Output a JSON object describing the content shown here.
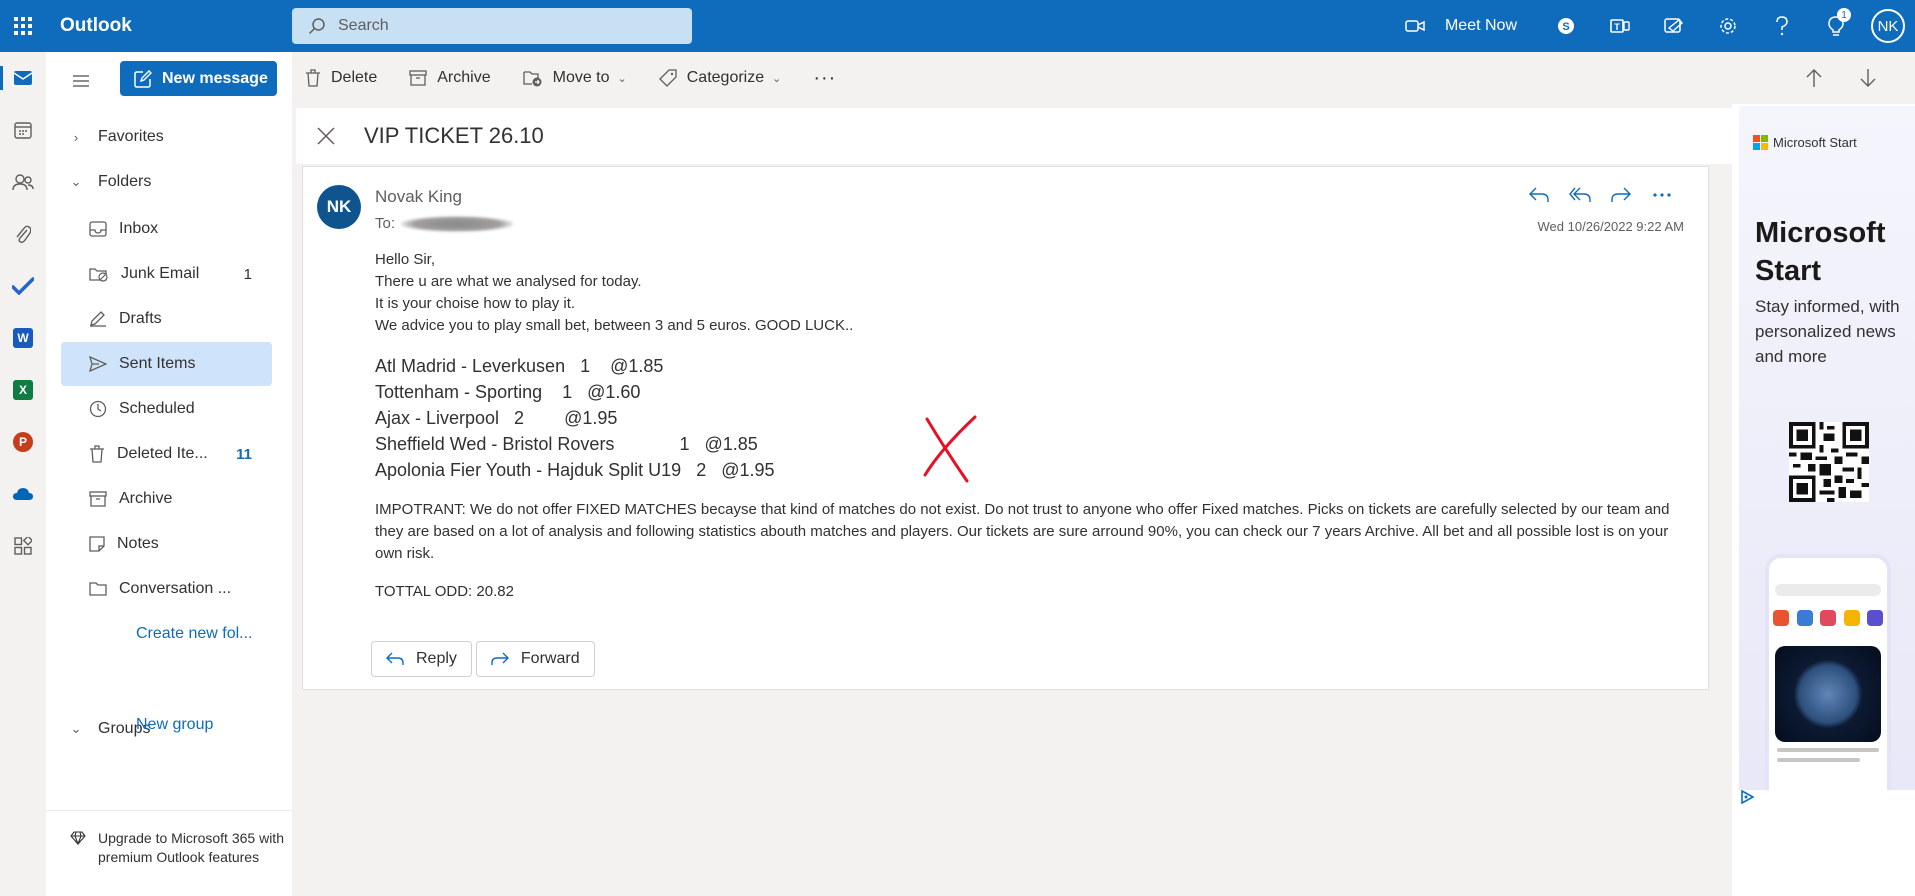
{
  "topbar": {
    "app_name": "Outlook",
    "search_placeholder": "Search",
    "meet_now": "Meet Now",
    "notification_count": "1",
    "user_initials": "NK",
    "colors": {
      "brand": "#0f6cbd",
      "search_bg": "#c7e0f4"
    }
  },
  "folders": {
    "new_message": "New message",
    "favorites": "Favorites",
    "folders_head": "Folders",
    "items": [
      {
        "label": "Inbox",
        "count": ""
      },
      {
        "label": "Junk Email",
        "count": "1"
      },
      {
        "label": "Drafts",
        "count": ""
      },
      {
        "label": "Sent Items",
        "count": ""
      },
      {
        "label": "Scheduled",
        "count": ""
      },
      {
        "label": "Deleted Ite...",
        "count": "11"
      },
      {
        "label": "Archive",
        "count": ""
      },
      {
        "label": "Notes",
        "count": ""
      },
      {
        "label": "Conversation ...",
        "count": ""
      }
    ],
    "create_new": "Create new fol...",
    "groups": "Groups",
    "new_group": "New group",
    "upgrade": "Upgrade to Microsoft 365 with premium Outlook features"
  },
  "commands": {
    "delete": "Delete",
    "archive": "Archive",
    "move_to": "Move to",
    "categorize": "Categorize",
    "more": "···"
  },
  "message": {
    "subject": "VIP TICKET 26.10",
    "sender_initials": "NK",
    "sender": "Novak King",
    "to_label": "To:",
    "date": "Wed 10/26/2022 9:22 AM",
    "greeting": [
      "Hello Sir,",
      "There u are what we analysed for today.",
      "It is your choise how to play it.",
      "We advice you to play small bet, between 3 and 5 euros. GOOD LUCK.."
    ],
    "picks": [
      "Atl Madrid - Leverkusen   1    @1.85",
      "Tottenham - Sporting    1   @1.60",
      "Ajax - Liverpool   2        @1.95",
      "Sheffield Wed - Bristol Rovers             1   @1.85",
      "Apolonia Fier Youth - Hajduk Split U19   2   @1.95"
    ],
    "notice": "IMPOTRANT: We do not offer FIXED MATCHES becayse that kind of matches do not exist. Do not trust to anyone who offer Fixed matches. Picks on tickets are carefully selected by our team and they are based on a lot of analysis and following statistics abouth matches and players. Our tickets are sure arround 90%, you can check our 7 years Archive. All bet and all possible lost is on your own risk.",
    "total": "TOTTAL ODD: 20.82",
    "reply": "Reply",
    "forward": "Forward"
  },
  "ad": {
    "brand": "Microsoft Start",
    "title": "Microsoft Start",
    "subtitle": "Stay informed, with personalized news and more"
  },
  "icons": [
    "waffle-icon",
    "search-icon",
    "video-icon",
    "skype-icon",
    "teams-icon",
    "whiteboard-icon",
    "gear-icon",
    "help-icon",
    "lightbulb-icon",
    "mail-icon",
    "calendar-icon",
    "people-icon",
    "attach-icon",
    "todo-icon",
    "word-icon",
    "excel-icon",
    "powerpoint-icon",
    "onedrive-icon",
    "apps-icon",
    "hamburger-icon",
    "compose-icon",
    "trash-icon",
    "archive-icon",
    "move-icon",
    "tag-icon",
    "arrow-up-icon",
    "arrow-down-icon",
    "close-icon",
    "reply-icon",
    "reply-all-icon",
    "forward-icon",
    "more-icon",
    "diamond-icon",
    "qr-code-icon",
    "adchoices-icon"
  ]
}
